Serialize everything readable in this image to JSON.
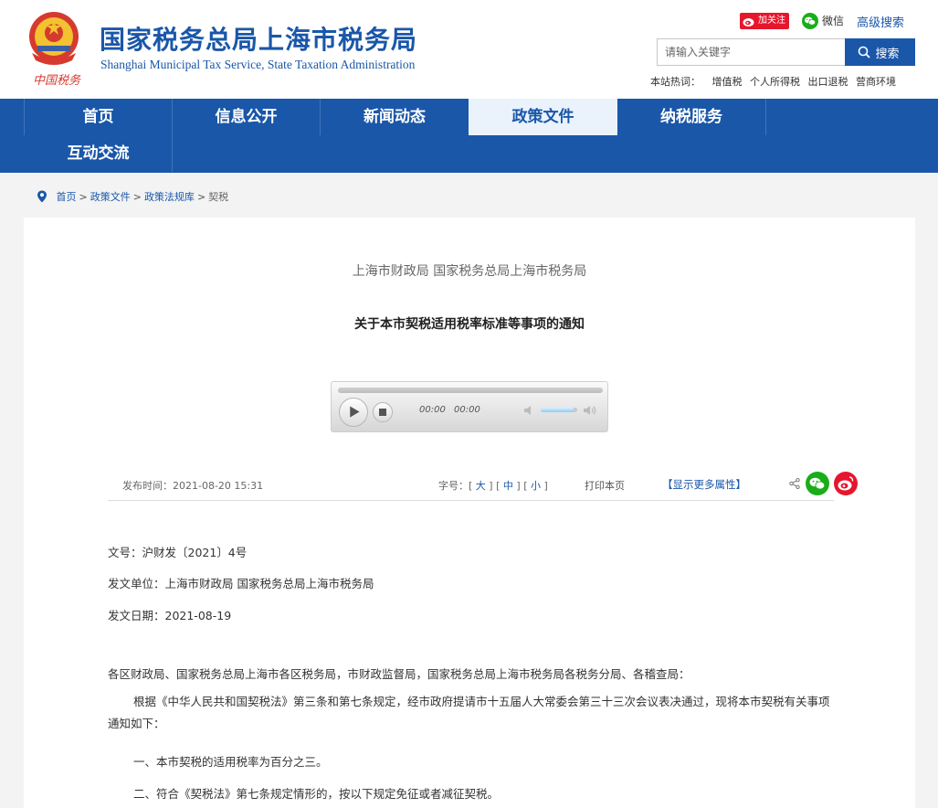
{
  "header": {
    "title": "国家税务总局上海市税务局",
    "subtitle": "Shanghai Municipal Tax Service, State Taxation Administration",
    "emblem_caption": "中国税务",
    "weibo_follow": "加关注",
    "wechat": "微信",
    "advanced_search": "高级搜索",
    "search": {
      "placeholder": "请输入关键字",
      "button": "搜索"
    },
    "hotwords_label": "本站热词：",
    "hotwords": [
      "增值税",
      "个人所得税",
      "出口退税",
      "营商环境"
    ]
  },
  "nav": {
    "items": [
      "首页",
      "信息公开",
      "新闻动态",
      "政策文件",
      "纳税服务",
      "互动交流"
    ],
    "active": "政策文件"
  },
  "breadcrumb": [
    "首页",
    "政策文件",
    "政策法规库",
    "契税"
  ],
  "article": {
    "issuer": "上海市财政局 国家税务总局上海市税务局",
    "title": "关于本市契税适用税率标准等事项的通知",
    "player": {
      "current_time": "00:00",
      "total_time": "00:00",
      "progress": 0,
      "volume": 0.9
    },
    "meta": {
      "published": "发布时间：2021-08-20 15:31",
      "font_size_label": "字号：",
      "font_sizes": [
        "大",
        "中",
        "小"
      ],
      "print": "打印本页",
      "more_attributes": "【显示更多属性】"
    },
    "doc_number": "文号：沪财发〔2021〕4号",
    "issuing_unit": "发文单位：上海市财政局 国家税务总局上海市税务局",
    "issue_date": "发文日期：2021-08-19",
    "addressee": "各区财政局、国家税务总局上海市各区税务局，市财政监督局，国家税务总局上海市税务局各税务分局、各稽查局：",
    "paragraph1": "根据《中华人民共和国契税法》第三条和第七条规定，经市政府提请市十五届人大常委会第三十三次会议表决通过，现将本市契税有关事项通知如下：",
    "item1": "一、本市契税的适用税率为百分之三。",
    "item2": "二、符合《契税法》第七条规定情形的，按以下规定免征或者减征契税。"
  },
  "colors": {
    "brand_blue": "#1a57a8",
    "weibo_red": "#e6162d",
    "wechat_green": "#1aad19"
  }
}
